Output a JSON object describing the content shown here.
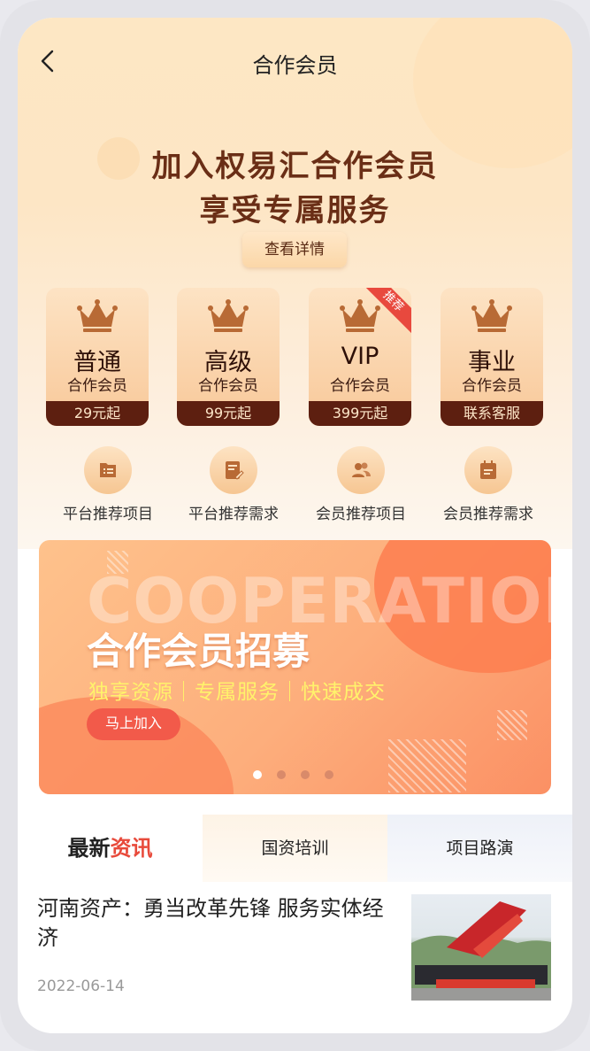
{
  "navbar": {
    "title": "合作会员"
  },
  "hero": {
    "line1": "加入权易汇合作会员",
    "line2": "享受专属服务",
    "detail_button": "查看详情"
  },
  "tiers": [
    {
      "name": "普通",
      "sub": "合作会员",
      "price": "29元起"
    },
    {
      "name": "高级",
      "sub": "合作会员",
      "price": "99元起"
    },
    {
      "name": "VIP",
      "sub": "合作会员",
      "price": "399元起",
      "badge": "推荐"
    },
    {
      "name": "事业",
      "sub": "合作会员",
      "price": "联系客服"
    }
  ],
  "features": [
    {
      "label": "平台推荐项目",
      "icon": "list-icon"
    },
    {
      "label": "平台推荐需求",
      "icon": "edit-doc-icon"
    },
    {
      "label": "会员推荐项目",
      "icon": "users-icon"
    },
    {
      "label": "会员推荐需求",
      "icon": "calendar-icon"
    }
  ],
  "banner": {
    "bg_word": "COOPERATION",
    "title": "合作会员招募",
    "subtitle": "独享资源｜专属服务｜快速成交",
    "join_button": "马上加入",
    "dots_total": 4,
    "dots_active": 1
  },
  "tabs": {
    "t1_part1": "最新",
    "t1_part2": "资讯",
    "t2": "国资培训",
    "t3": "项目路演"
  },
  "news": {
    "title": "河南资产：勇当改革先锋 服务实体经济",
    "date": "2022-06-14"
  },
  "colors": {
    "accent": "#e84a3b",
    "brown": "#5d1f10",
    "gold": "#f8c899"
  }
}
